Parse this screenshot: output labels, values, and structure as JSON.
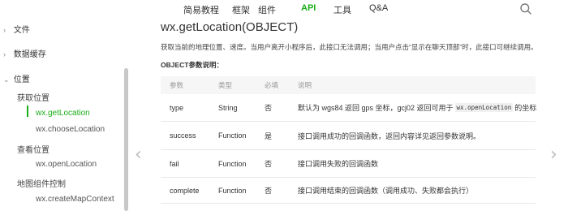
{
  "nav": {
    "items": [
      "简易教程",
      "框架",
      "组件",
      "API",
      "工具",
      "Q&A"
    ],
    "active": "API",
    "accent": "#1aad19",
    "search_icon": "search-icon"
  },
  "sidebar": {
    "categories": [
      {
        "label": "文件",
        "icon": "chevron-right-icon"
      },
      {
        "label": "数据缓存",
        "icon": "chevron-right-icon"
      },
      {
        "label": "位置",
        "icon": "chevron-down-icon"
      }
    ],
    "groups": [
      {
        "label": "获取位置",
        "items": [
          "wx.getLocation",
          "wx.chooseLocation"
        ]
      },
      {
        "label": "查看位置",
        "items": [
          "wx.openLocation"
        ]
      },
      {
        "label": "地图组件控制",
        "items": [
          "wx.createMapContext"
        ]
      }
    ],
    "active_item": "wx.getLocation"
  },
  "main": {
    "title": "wx.getLocation(OBJECT)",
    "description": "获取当前的地理位置、速度。当用户离开小程序后，此接口无法调用；当用户点击“显示在聊天顶部”时，此接口可继续调用。",
    "params_title": "OBJECT参数说明：",
    "table": {
      "headers": [
        "参数",
        "类型",
        "必填",
        "说明"
      ],
      "rows": [
        {
          "param": "type",
          "type": "String",
          "required": "否",
          "desc_before": "默认为 wgs84 返回 gps 坐标，gcj02 返回可用于",
          "desc_code": "wx.openLocation",
          "desc_after": "的坐标"
        },
        {
          "param": "success",
          "type": "Function",
          "required": "是",
          "desc_before": "接口调用成功的回调函数，返回内容详见返回参数说明。",
          "desc_code": "",
          "desc_after": ""
        },
        {
          "param": "fail",
          "type": "Function",
          "required": "否",
          "desc_before": "接口调用失败的回调函数",
          "desc_code": "",
          "desc_after": ""
        },
        {
          "param": "complete",
          "type": "Function",
          "required": "否",
          "desc_before": "接口调用结束的回调函数（调用成功、失败都会执行）",
          "desc_code": "",
          "desc_after": ""
        }
      ]
    }
  },
  "pager": {
    "prev_icon": "chevron-left-icon",
    "next_icon": "chevron-right-icon"
  }
}
